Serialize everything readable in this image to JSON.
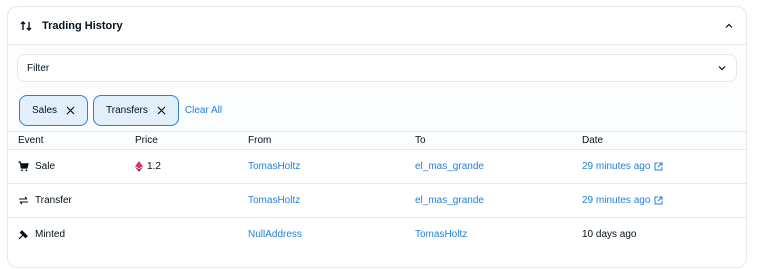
{
  "panel": {
    "title": "Trading History",
    "title_icon": "arrows-up-down-icon",
    "collapse_icon": "chevron-up-icon"
  },
  "filter": {
    "label": "Filter",
    "icon": "chevron-down-icon"
  },
  "chips": [
    {
      "label": "Sales"
    },
    {
      "label": "Transfers"
    }
  ],
  "clear_all": "Clear All",
  "table": {
    "columns": [
      "Event",
      "Price",
      "From",
      "To",
      "Date"
    ],
    "rows": [
      {
        "event": "Sale",
        "event_icon": "cart-icon",
        "price": "1.2",
        "price_icon": "ethereum-icon",
        "from": "TomasHoltz",
        "to": "el_mas_grande",
        "date": "29 minutes ago",
        "date_link": true
      },
      {
        "event": "Transfer",
        "event_icon": "transfer-arrows-icon",
        "price": "",
        "from": "TomasHoltz",
        "to": "el_mas_grande",
        "date": "29 minutes ago",
        "date_link": true
      },
      {
        "event": "Minted",
        "event_icon": "minted-icon",
        "price": "",
        "from": "NullAddress",
        "to": "TomasHoltz",
        "date": "10 days ago",
        "date_link": false
      }
    ]
  },
  "colors": {
    "accent": "#2081e2",
    "border": "#e5e8eb",
    "chip_bg": "#e3f0fb",
    "text": "#04111d",
    "eth": "#e2336b"
  }
}
